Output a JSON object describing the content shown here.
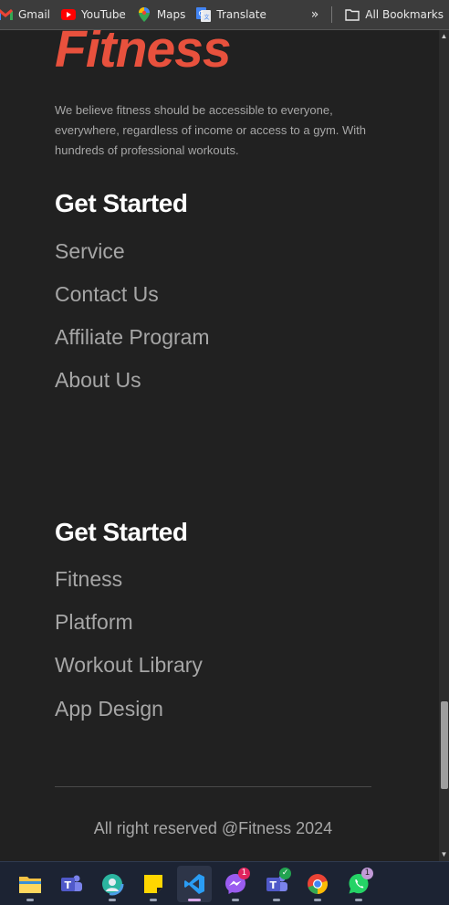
{
  "bookmarks": [
    {
      "label": "Gmail",
      "icon": "gmail-icon"
    },
    {
      "label": "YouTube",
      "icon": "youtube-icon"
    },
    {
      "label": "Maps",
      "icon": "maps-icon"
    },
    {
      "label": "Translate",
      "icon": "translate-icon"
    }
  ],
  "bookmarks_more": "»",
  "all_bookmarks": "All Bookmarks",
  "footer": {
    "logo": "Fitness",
    "tagline": "We believe fitness should be accessible to everyone, everywhere, regardless of income or access to a gym. With hundreds of professional workouts.",
    "sections": [
      {
        "title": "Get Started",
        "links": [
          "Service",
          "Contact Us",
          "Affiliate Program",
          "About Us"
        ]
      },
      {
        "title": "Get Started",
        "links": [
          "Fitness",
          "Platform",
          "Workout Library",
          "App Design"
        ]
      }
    ],
    "copyright": "All right reserved @Fitness 2024"
  },
  "taskbar": {
    "apps": [
      {
        "name": "file-explorer-icon"
      },
      {
        "name": "teams-icon"
      },
      {
        "name": "copilot-icon"
      },
      {
        "name": "sticky-notes-icon"
      },
      {
        "name": "vscode-icon",
        "active": true
      },
      {
        "name": "messenger-icon",
        "badge": "1"
      },
      {
        "name": "teams-work-icon",
        "badge": "✓"
      },
      {
        "name": "chrome-icon"
      },
      {
        "name": "whatsapp-icon",
        "badge": "1"
      }
    ]
  },
  "colors": {
    "brand": "#e8513d",
    "background": "#212121",
    "link": "#a6a6a6",
    "heading": "#ffffff"
  }
}
